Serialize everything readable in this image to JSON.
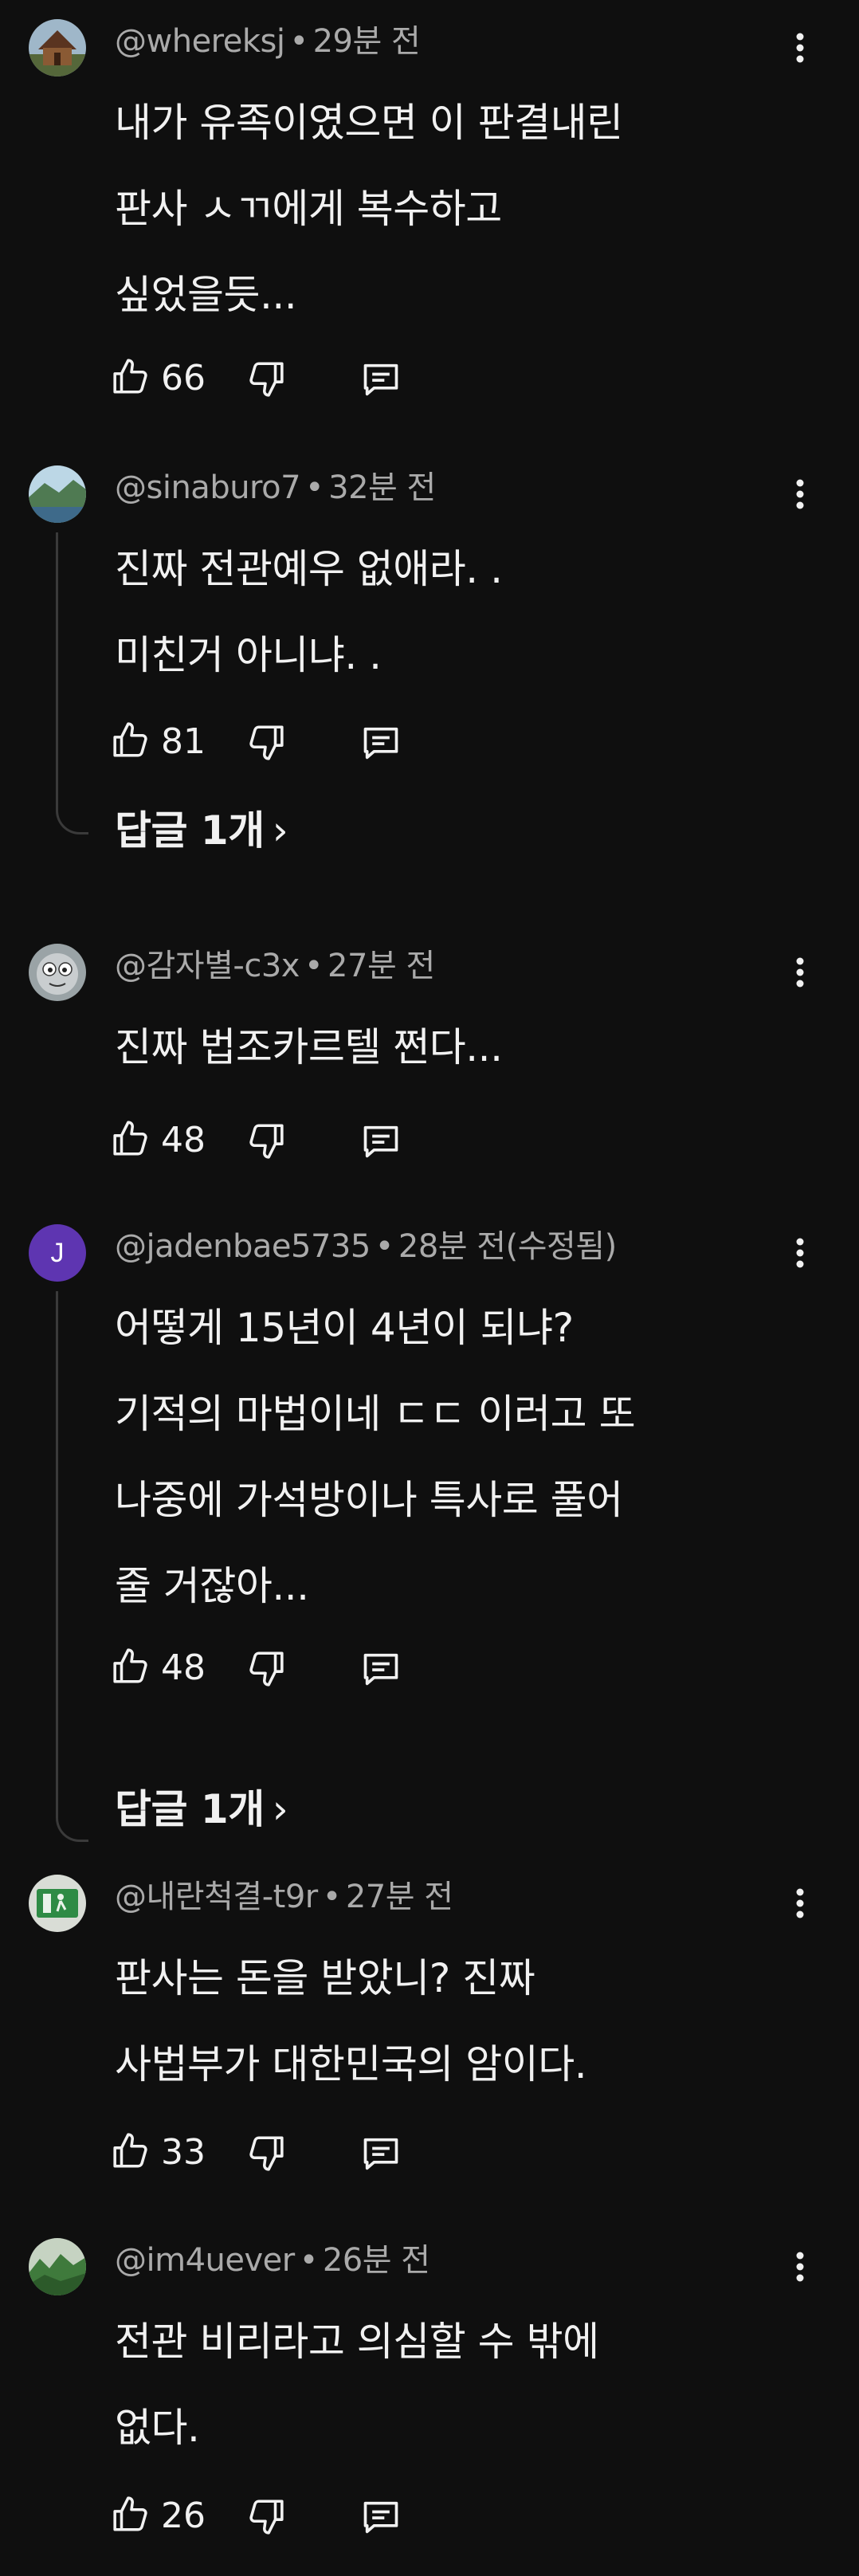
{
  "comments": [
    {
      "author": "@whereksj",
      "time": "29분 전",
      "lines": [
        "내가 유족이였으면 이 판결내린",
        "판사 ㅅㄲ에게 복수하고",
        "싶었을듯..."
      ],
      "likes": "66",
      "avatar": "cabin-photo-avatar"
    },
    {
      "author": "@sinaburo7",
      "time": "32분 전",
      "lines": [
        "진짜 전관예우 없애라. .",
        "미친거 아니냐. ."
      ],
      "likes": "81",
      "replies": "답글 1개",
      "avatar": "landscape-photo-avatar"
    },
    {
      "author": "@감자별-c3x",
      "time": "27분 전",
      "lines": [
        "진짜 법조카르텔 쩐다..."
      ],
      "likes": "48",
      "avatar": "cartoon-face-avatar"
    },
    {
      "author": "@jadenbae5735",
      "time": "28분 전(수정됨)",
      "lines": [
        "어떻게 15년이 4년이 되냐?",
        "기적의 마법이네 ㄷㄷ 이러고 또",
        "나중에 가석방이나 특사로 풀어",
        "줄 거잖아..."
      ],
      "likes": "48",
      "replies": "답글 1개",
      "avatar_letter": "J",
      "avatar_color": "#5e35b1"
    },
    {
      "author": "@내란척결-t9r",
      "time": "27분 전",
      "lines": [
        "판사는 돈을 받았니? 진짜",
        "사법부가 대한민국의 암이다."
      ],
      "likes": "33",
      "avatar": "exit-sign-avatar"
    },
    {
      "author": "@im4uever",
      "time": "26분 전",
      "lines": [
        "전관 비리라고 의심할 수 밖에",
        "없다."
      ],
      "likes": "26",
      "avatar": "forest-photo-avatar"
    }
  ],
  "icons": {
    "like": "thumb-up-icon",
    "dislike": "thumb-down-icon",
    "reply": "reply-comment-icon",
    "more": "more-vertical-icon",
    "chevron": "chevron-right-icon"
  },
  "colors": {
    "background": "#0f0f0f",
    "text": "#f1f1f1",
    "meta": "#aaaaaa",
    "thread_line": "#3a3a3a"
  }
}
